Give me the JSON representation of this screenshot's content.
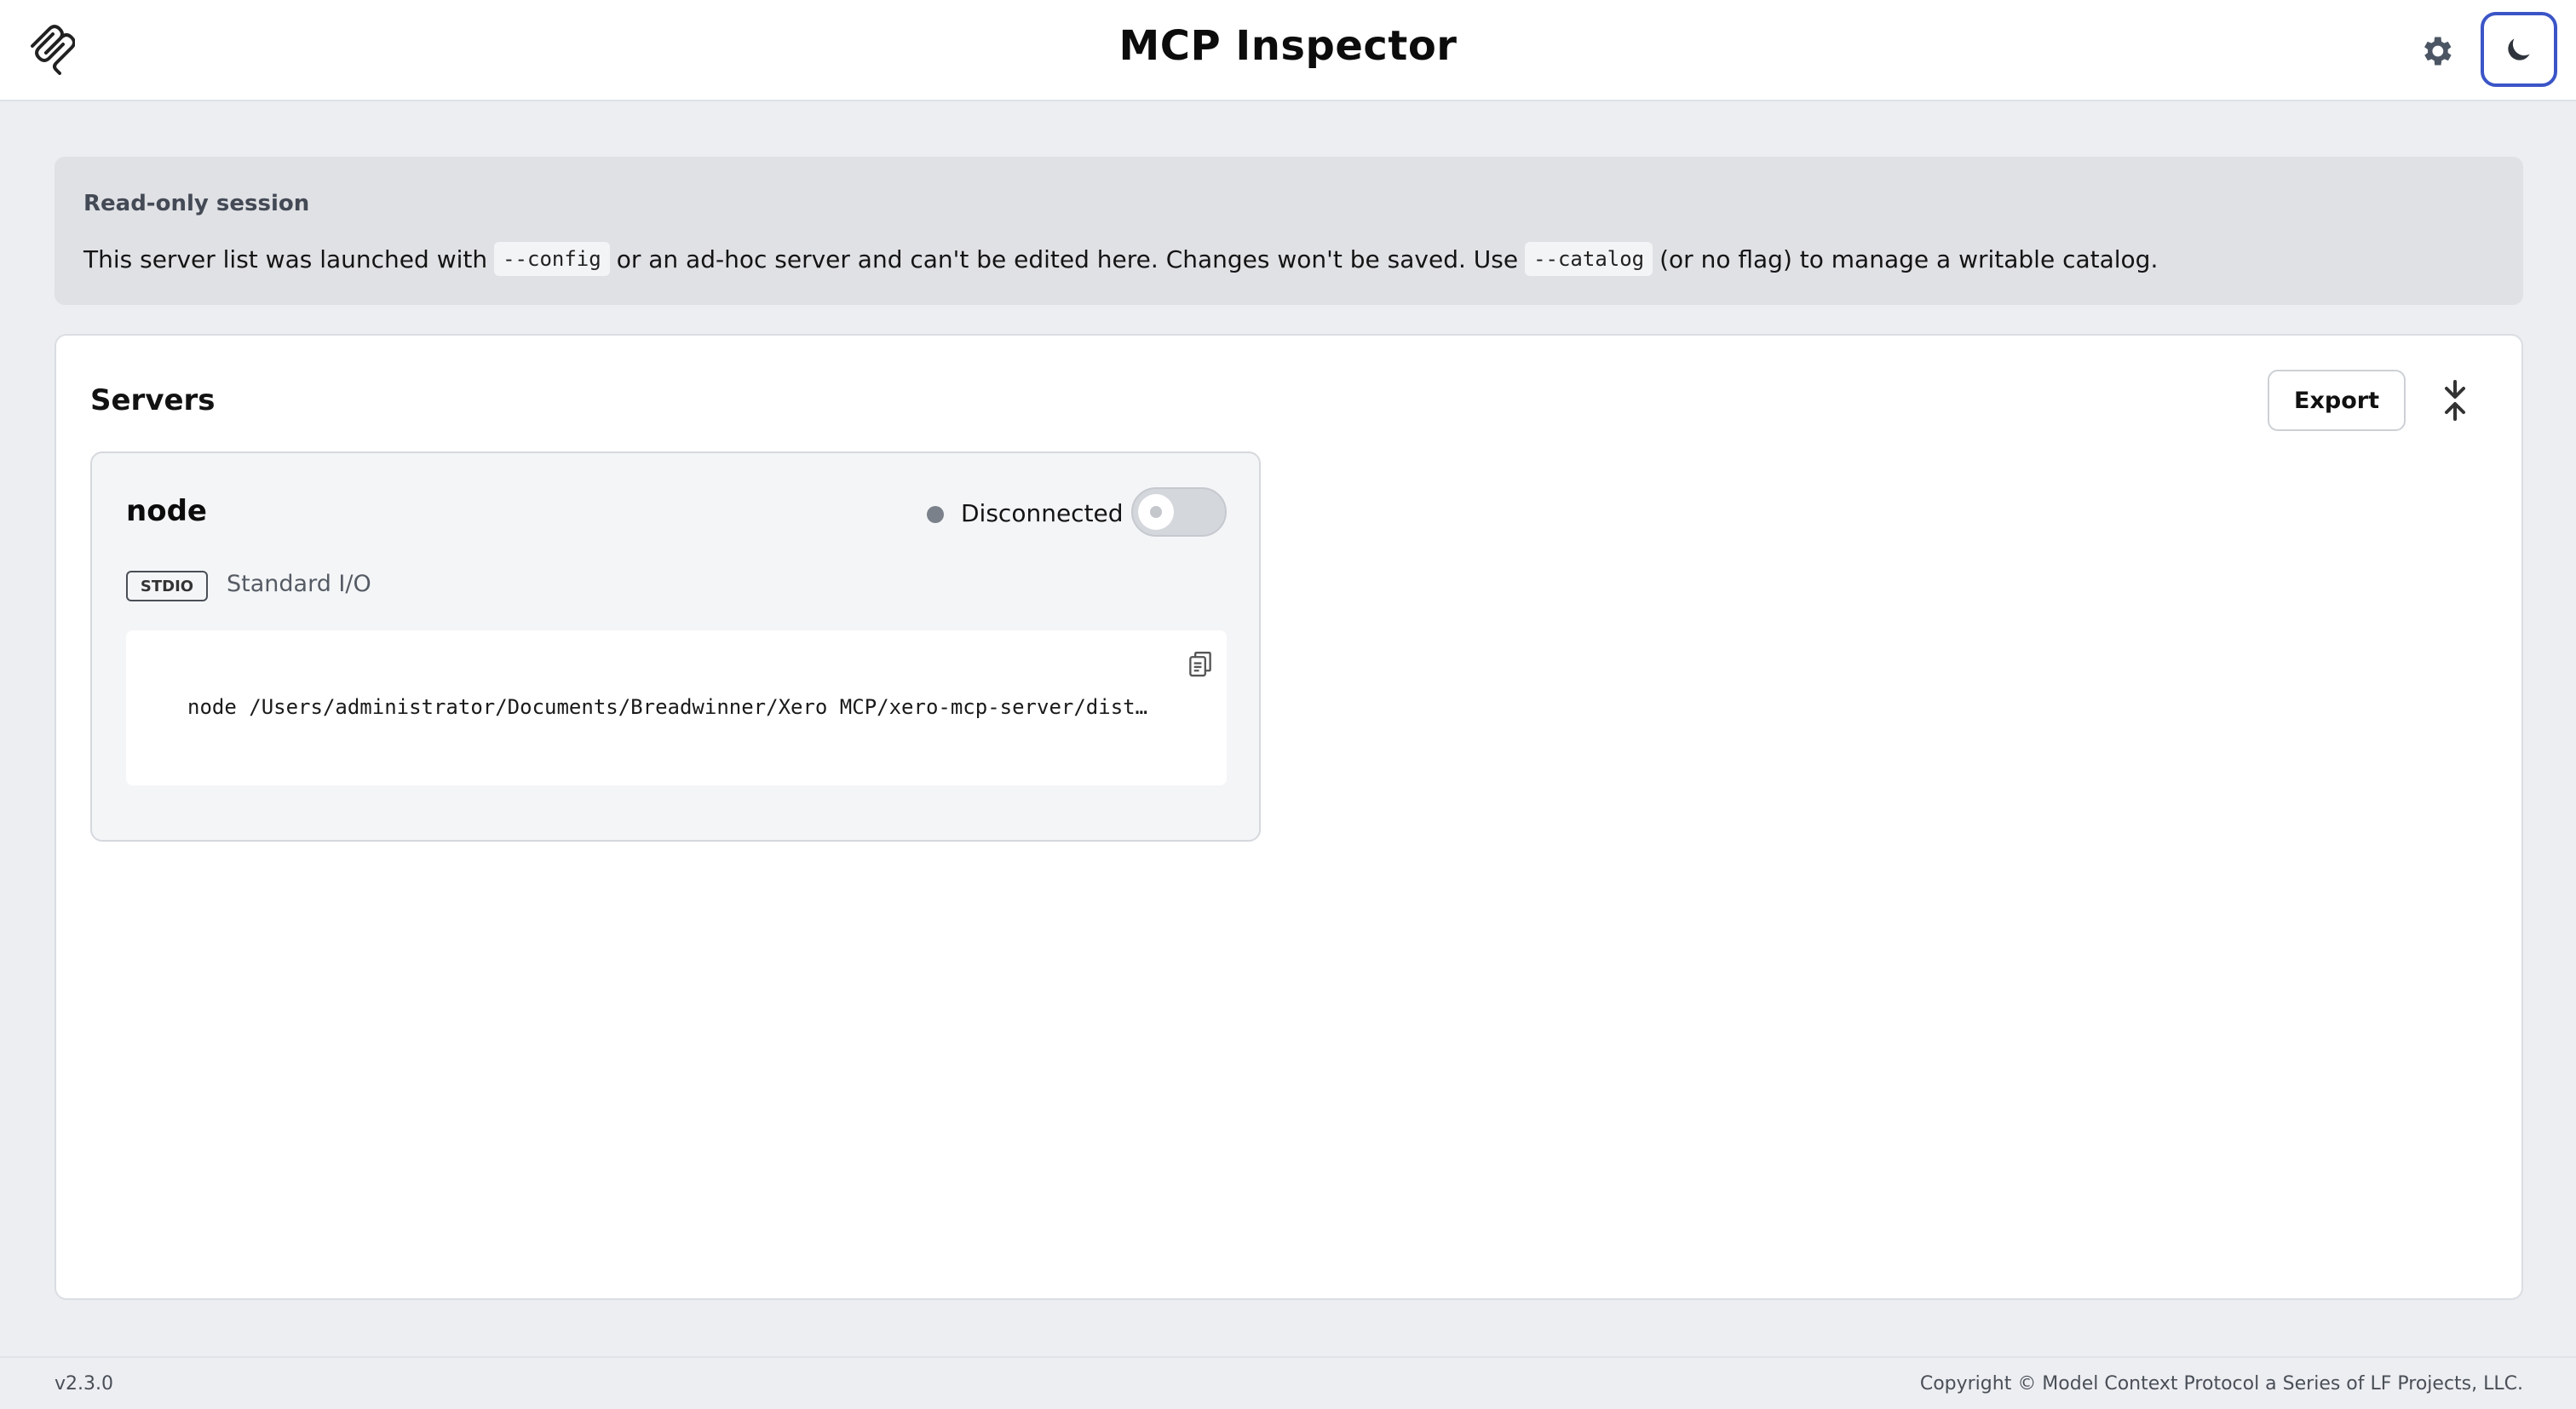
{
  "header": {
    "title": "MCP Inspector",
    "logo_icon": "mcp-logo-icon",
    "settings_icon": "gear-icon",
    "theme_icon": "moon-icon"
  },
  "notice": {
    "title": "Read-only session",
    "text_before_config": "This server list was launched with",
    "config_flag": "--config",
    "text_middle": "or an ad-hoc server and can't be edited here. Changes won't be saved. Use",
    "catalog_flag": "--catalog",
    "text_after_catalog": "(or no flag) to manage a writable catalog."
  },
  "servers": {
    "title": "Servers",
    "export_label": "Export",
    "collapse_icon": "collapse-icon",
    "items": [
      {
        "name": "node",
        "status": "Disconnected",
        "connected": false,
        "transport_badge": "STDIO",
        "transport_label": "Standard I/O",
        "command": "node /Users/administrator/Documents/Breadwinner/Xero MCP/xero-mcp-server/dist/…",
        "copy_icon": "copy-icon"
      }
    ]
  },
  "footer": {
    "version": "v2.3.0",
    "copyright": "Copyright © Model Context Protocol a Series of LF Projects, LLC."
  },
  "colors": {
    "accent": "#3b55c7",
    "status_disconnected": "#7b818b",
    "background": "#eceef2"
  }
}
